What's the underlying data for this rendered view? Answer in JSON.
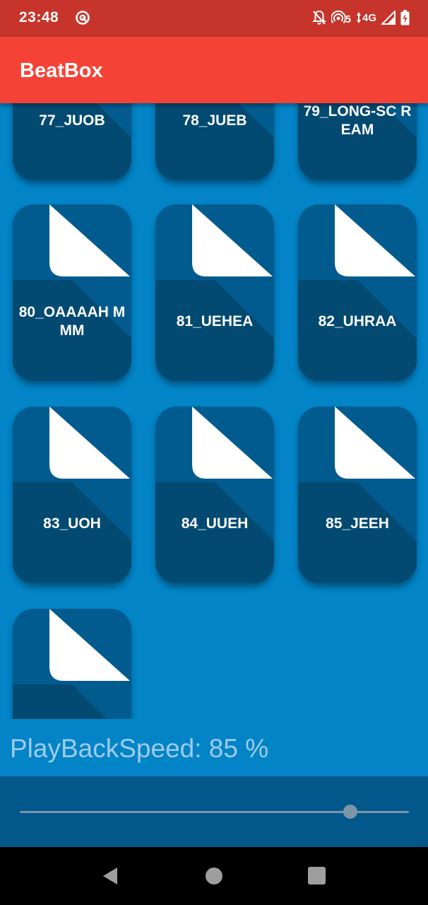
{
  "status_bar": {
    "time": "23:48",
    "network_label": "4G",
    "hotspot_badge": "5",
    "icons": [
      "app-notification-icon",
      "mute-bell-icon",
      "hotspot-icon",
      "data-arrows-icon",
      "signal-icon",
      "battery-icon"
    ]
  },
  "app_bar": {
    "title": "BeatBox"
  },
  "sounds": [
    {
      "label": "77_JUOB"
    },
    {
      "label": "78_JUEB"
    },
    {
      "label": "79_LONG-SC REAM"
    },
    {
      "label": "80_OAAAAH MMM"
    },
    {
      "label": "81_UEHEA"
    },
    {
      "label": "82_UHRAA"
    },
    {
      "label": "83_UOH"
    },
    {
      "label": "84_UUEH"
    },
    {
      "label": "85_JEEH"
    },
    {
      "label": ""
    }
  ],
  "playback": {
    "label": "PlayBackSpeed: 85 %",
    "speed_percent": 85
  },
  "colors": {
    "status_bar": "#c7342b",
    "app_bar": "#f44336",
    "background": "#0284c7",
    "button": "#025b8f",
    "button_shadow_fold": "#024a72",
    "page_white": "#ffffff",
    "slider_area": "#02588a"
  },
  "nav": {
    "icons": [
      "back-icon",
      "home-icon",
      "recents-icon"
    ]
  }
}
